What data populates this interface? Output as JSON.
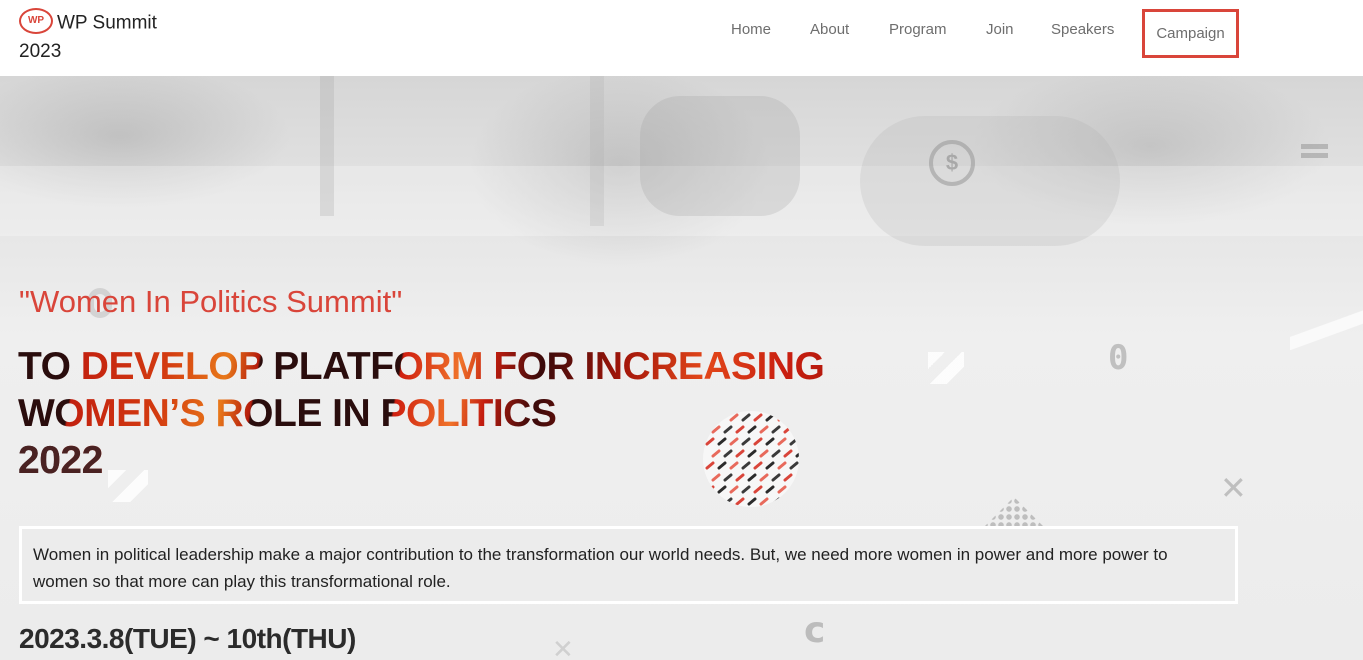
{
  "header": {
    "logo_badge": "WP",
    "brand_name": "WP Summit",
    "brand_year": "2023",
    "nav": [
      {
        "label": "Home"
      },
      {
        "label": "About"
      },
      {
        "label": "Program"
      },
      {
        "label": "Join"
      },
      {
        "label": "Speakers"
      },
      {
        "label": "Campaign",
        "highlighted": true
      }
    ]
  },
  "hero": {
    "subtitle": "\"Women In Politics Summit\"",
    "headline_lines": [
      "TO DEVELOP PLATFORM FOR INCREASING",
      "WOMEN’S ROLE IN POLITICS",
      "2022"
    ],
    "description": "Women in political leadership make a major contribution to the transformation our world needs. But, we need more women in power and more power to women so that more can play this transformational role.",
    "dates": "2023.3.8(TUE) ~ 10th(THU)"
  },
  "colors": {
    "accent": "#d9453a",
    "headline_dark": "#2a0d0d",
    "headline_red": "#c2200f"
  },
  "icons": {
    "background_symbols": [
      "no-dollar-icon",
      "menu-bars-icon",
      "zero-glyph",
      "close-x-icon",
      "c-glyph",
      "diamond-dots-icon"
    ],
    "pattern": "patterned-circle-graphic"
  }
}
